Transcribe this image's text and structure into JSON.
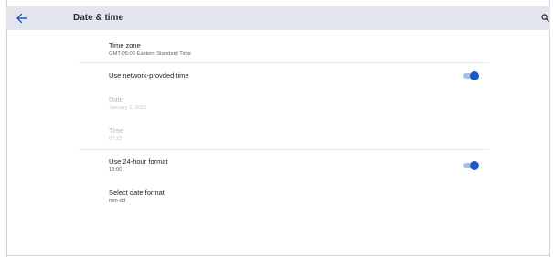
{
  "header": {
    "title": "Date & time",
    "back_icon": "arrow-left-icon",
    "search_icon": "search-icon"
  },
  "settings": {
    "time_zone": {
      "title": "Time zone",
      "value": "GMT-05:00 Eastern Standard Time"
    },
    "network_time": {
      "title": "Use network-provded time",
      "enabled": true
    },
    "date": {
      "title": "Date",
      "value": "January 1, 2021",
      "disabled": true
    },
    "time": {
      "title": "Time",
      "value": "07:23",
      "disabled": true
    },
    "hour_format": {
      "title": "Use 24-hour format",
      "value": "13:00",
      "enabled": true
    },
    "date_format": {
      "title": "Select date format",
      "value": "mm-dd"
    }
  },
  "colors": {
    "accent": "#1b5cc4",
    "toggle_track": "#a9c0e6",
    "header_bg": "#e3e7ed"
  }
}
